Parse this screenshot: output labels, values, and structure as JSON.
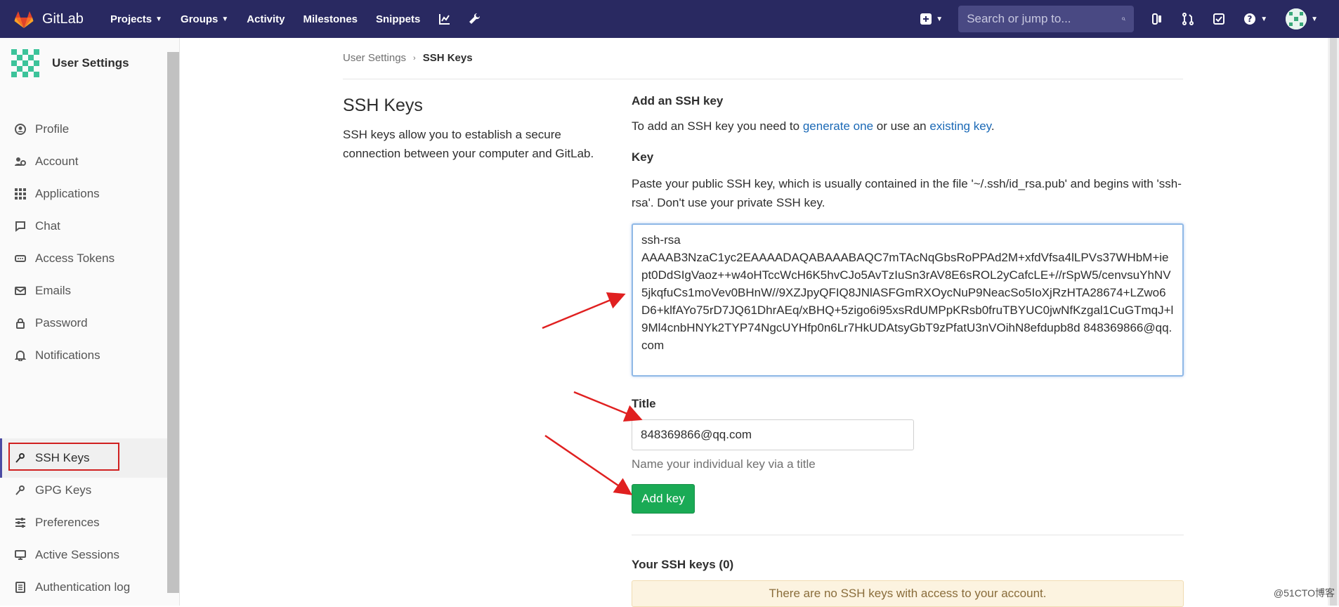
{
  "brand": {
    "name": "GitLab",
    "colors": {
      "nav_bg": "#292961",
      "accent_green": "#1aaa55",
      "link": "#1b69b6"
    }
  },
  "nav": {
    "links": [
      {
        "label": "Projects",
        "has_dropdown": true
      },
      {
        "label": "Groups",
        "has_dropdown": true
      },
      {
        "label": "Activity"
      },
      {
        "label": "Milestones"
      },
      {
        "label": "Snippets"
      }
    ],
    "search_placeholder": "Search or jump to..."
  },
  "sidebar": {
    "title": "User Settings",
    "items": [
      {
        "label": "Profile",
        "icon": "profile-icon"
      },
      {
        "label": "Account",
        "icon": "account-icon"
      },
      {
        "label": "Applications",
        "icon": "applications-icon"
      },
      {
        "label": "Chat",
        "icon": "chat-icon"
      },
      {
        "label": "Access Tokens",
        "icon": "token-icon"
      },
      {
        "label": "Emails",
        "icon": "email-icon"
      },
      {
        "label": "Password",
        "icon": "lock-icon"
      },
      {
        "label": "Notifications",
        "icon": "bell-icon"
      },
      {
        "label": "SSH Keys",
        "icon": "key-icon",
        "active": true
      },
      {
        "label": "GPG Keys",
        "icon": "key-icon"
      },
      {
        "label": "Preferences",
        "icon": "sliders-icon"
      },
      {
        "label": "Active Sessions",
        "icon": "monitor-icon"
      },
      {
        "label": "Authentication log",
        "icon": "log-icon"
      }
    ]
  },
  "breadcrumb": {
    "parent": "User Settings",
    "current": "SSH Keys"
  },
  "page": {
    "title": "SSH Keys",
    "description": "SSH keys allow you to establish a secure connection between your computer and GitLab.",
    "add_heading": "Add an SSH key",
    "add_text_pre": "To add an SSH key you need to ",
    "add_link1": "generate one",
    "add_text_mid": " or use an ",
    "add_link2": "existing key",
    "add_text_post": ".",
    "key_label": "Key",
    "key_help": "Paste your public SSH key, which is usually contained in the file '~/.ssh/id_rsa.pub' and begins with 'ssh-rsa'. Don't use your private SSH key.",
    "key_value": "ssh-rsa\nAAAAB3NzaC1yc2EAAAADAQABAAABAQC7mTAcNqGbsRoPPAd2M+xfdVfsa4lLPVs37WHbM+iept0DdSIgVaoz++w4oHTccWcH6K5hvCJo5AvTzIuSn3rAV8E6sROL2yCafcLE+//rSpW5/cenvsuYhNV5jkqfuCs1moVev0BHnW//9XZJpyQFIQ8JNlASFGmRXOycNuP9NeacSo5IoXjRzHTA28674+LZwo6D6+klfAYo75rD7JQ61DhrAEq/xBHQ+5zigo6i95xsRdUMPpKRsb0fruTBYUC0jwNfKzgal1CuGTmqJ+l9Ml4cnbHNYk2TYP74NgcUYHfp0n6Lr7HkUDAtsyGbT9zPfatU3nVOihN8efdupb8d 848369866@qq.com",
    "title_label": "Title",
    "title_value": "848369866@qq.com",
    "title_hint": "Name your individual key via a title",
    "add_button": "Add key",
    "your_keys_heading": "Your SSH keys (0)",
    "empty_message": "There are no SSH keys with access to your account."
  },
  "watermark": "@51CTO博客"
}
